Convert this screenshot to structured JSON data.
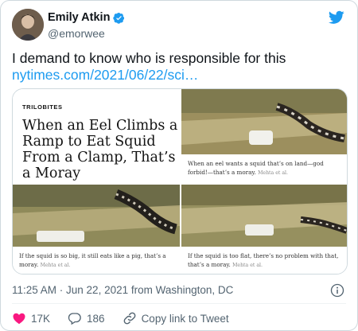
{
  "author": {
    "name": "Emily Atkin",
    "handle": "@emorwee",
    "verified": true
  },
  "tweet": {
    "text": "I demand to know who is responsible for this",
    "link": "nytimes.com/2021/06/22/sci…"
  },
  "media": {
    "kicker": "TRILOBITES",
    "headline": "When an Eel Climbs a Ramp to Eat Squid From a Clamp, That’s a Moray",
    "captions": [
      {
        "text": "When an eel wants a squid that’s on land—god forbid!—that’s a moray.",
        "credit": "Mehta et al."
      },
      {
        "text": "If the squid is so big, it still eats like a pig, that’s a moray.",
        "credit": "Mehta et al."
      },
      {
        "text": "If the squid is too flat, there’s no problem with that, that’s a moray.",
        "credit": "Mehta et al."
      }
    ]
  },
  "meta": {
    "timestamp": "11:25 AM · Jun 22, 2021 from Washington, DC"
  },
  "actions": {
    "likes": "17K",
    "replies": "186",
    "copy_link": "Copy link to Tweet"
  },
  "colors": {
    "accent": "#1d9bf0",
    "like": "#f91880",
    "text_secondary": "#536471"
  }
}
